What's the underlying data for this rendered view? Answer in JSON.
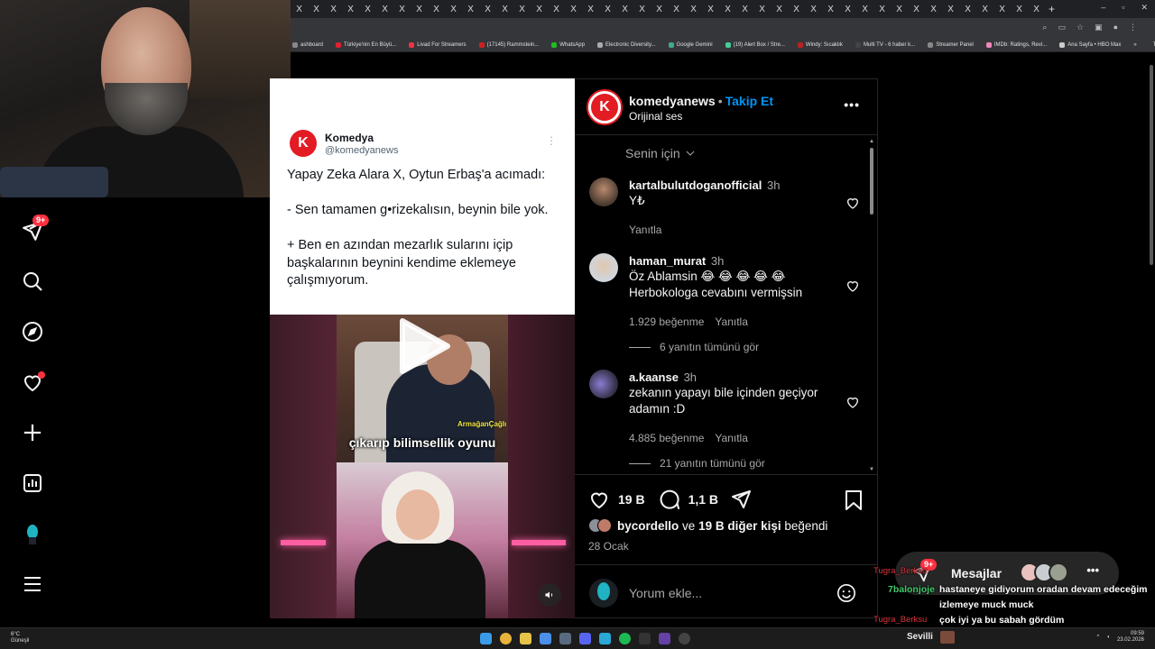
{
  "browser": {
    "tab_close_glyph": "X",
    "new_tab_glyph": "+",
    "window_controls": [
      "–",
      "▫",
      "✕"
    ],
    "bookmarks": [
      "ashboard",
      "Türkiye'nin En Büyü...",
      "Livad For Streamers",
      "(17145) Rammstein...",
      "WhatsApp",
      "Electronic Diversity...",
      "Google Gemini",
      "(19) Alert Box / Stre...",
      "Windy: Sıcaklık",
      "Multi TV - 6 haber k...",
      "Streamer Panel",
      "IMDb: Ratings, Revi...",
      "Ana Sayfa • HBO Max"
    ],
    "bookmarks_more": "»",
    "all_bookmarks": "Tüm Yer İşaretleri"
  },
  "sidebar": {
    "notifications_badge": "9+"
  },
  "tweet": {
    "logo_letter": "K",
    "display_name": "Komedya",
    "handle": "@komedyanews",
    "more": "⋮",
    "text": "Yapay Zeka Alara X, Oytun Erbaş'a acımadı:\n\n- Sen tamamen g•rizekalısın, beynin bile yok.\n\n+ Ben en azından mezarlık sularını içip başkalarının beynini kendime eklemeye çalışmıyorum."
  },
  "video": {
    "caption": "çıkarıp bilimsellik oyunu",
    "brand": "ArmağanÇağlı"
  },
  "post": {
    "avatar_letter": "K",
    "username": "komedyanews",
    "separator": "•",
    "follow": "Takip Et",
    "audio": "Orijinal ses",
    "more": "•••",
    "sort_label": "Senin için"
  },
  "comments": [
    {
      "username": "kartalbulutdoganofficial",
      "time": "3h",
      "text": "Y₺",
      "likes": "",
      "reply": "Yanıtla"
    },
    {
      "username": "haman_murat",
      "time": "3h",
      "text": "Öz Ablamsin 😂 😂 😂 😂 😂 Herbokologa cevabını vermişsin",
      "likes": "1.929 beğenme",
      "reply": "Yanıtla"
    },
    {
      "username": "a.kaanse",
      "time": "3h",
      "text": "zekanın yapayı bile içinden geçiyor adamın :D",
      "likes": "4.885 beğenme",
      "reply": "Yanıtla"
    }
  ],
  "view_replies": [
    "6 yanıtın tümünü gör",
    "21 yanıtın tümünü gör"
  ],
  "actions": {
    "likes": "19 B",
    "comments": "1,1 B",
    "liked_by_user": "bycordello",
    "liked_by_and": "ve",
    "liked_by_others": "19 B diğer kişi",
    "liked_by_suffix": "beğendi",
    "date": "28 Ocak"
  },
  "add_comment": {
    "placeholder": "Yorum ekle..."
  },
  "messages": {
    "label": "Mesajlar",
    "badge": "9+",
    "more": "•••"
  },
  "chat": [
    {
      "user": "Tugra_Berksu",
      "text": ""
    },
    {
      "user": "7balonjoje",
      "text": "hastaneye gidiyorum oradan devam edeceğim"
    },
    {
      "user": "",
      "text": "izlemeye muck muck"
    },
    {
      "user": "Tugra_Berksu",
      "text": "çok iyi ya bu sabah gördüm"
    }
  ],
  "taskbar": {
    "weather_temp": "6°C",
    "weather_desc": "Güneşli",
    "stream_user": "Sevilli",
    "time": "09:59",
    "date": "23.02.2026"
  },
  "colors": {
    "instagram_badge": "#ff3040",
    "follow_blue": "#0095f6",
    "komedya_red": "#e31b23"
  }
}
